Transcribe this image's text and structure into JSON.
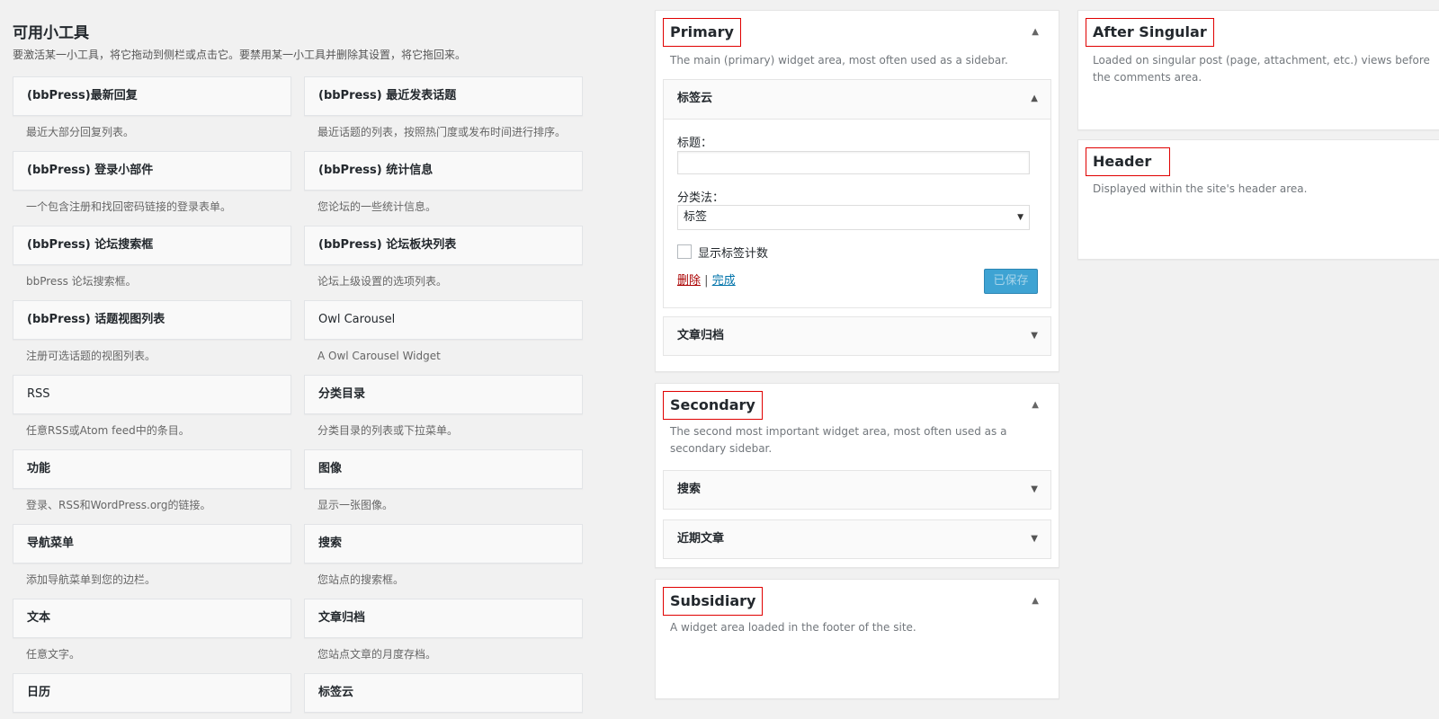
{
  "available": {
    "title": "可用小工具",
    "intro": "要激活某一小工具，将它拖动到侧栏或点击它。要禁用某一小工具并删除其设置，将它拖回来。",
    "widgets": [
      {
        "name": "(bbPress)最新回复",
        "desc": "最近大部分回复列表。"
      },
      {
        "name": "(bbPress) 最近发表话题",
        "desc": "最近话题的列表，按照热门度或发布时间进行排序。"
      },
      {
        "name": "(bbPress) 登录小部件",
        "desc": "一个包含注册和找回密码链接的登录表单。"
      },
      {
        "name": "(bbPress) 统计信息",
        "desc": "您论坛的一些统计信息。"
      },
      {
        "name": "(bbPress) 论坛搜索框",
        "desc": "bbPress 论坛搜索框。"
      },
      {
        "name": "(bbPress) 论坛板块列表",
        "desc": "论坛上级设置的选项列表。"
      },
      {
        "name": "(bbPress) 话题视图列表",
        "desc": "注册可选话题的视图列表。"
      },
      {
        "name": "Owl Carousel",
        "desc": "A Owl Carousel Widget"
      },
      {
        "name": "RSS",
        "desc": "任意RSS或Atom feed中的条目。"
      },
      {
        "name": "分类目录",
        "desc": "分类目录的列表或下拉菜单。"
      },
      {
        "name": "功能",
        "desc": "登录、RSS和WordPress.org的链接。"
      },
      {
        "name": "图像",
        "desc": "显示一张图像。"
      },
      {
        "name": "导航菜单",
        "desc": "添加导航菜单到您的边栏。"
      },
      {
        "name": "搜索",
        "desc": "您站点的搜索框。"
      },
      {
        "name": "文本",
        "desc": "任意文字。"
      },
      {
        "name": "文章归档",
        "desc": "您站点文章的月度存档。"
      },
      {
        "name": "日历",
        "desc": ""
      },
      {
        "name": "标签云",
        "desc": ""
      }
    ]
  },
  "primary": {
    "name": "Primary",
    "desc": "The main (primary) widget area, most often used as a sidebar.",
    "tagcloud": {
      "title": "标签云",
      "title_label": "标题：",
      "title_value": "",
      "taxonomy_label": "分类法：",
      "taxonomy_value": "标签",
      "show_count_label": "显示标签计数",
      "delete_label": "删除",
      "separator": "|",
      "done_label": "完成",
      "saved_label": "已保存"
    },
    "archives_title": "文章归档"
  },
  "secondary": {
    "name": "Secondary",
    "desc": "The second most important widget area, most often used as a secondary sidebar.",
    "widgets": [
      "搜索",
      "近期文章"
    ]
  },
  "subsidiary": {
    "name": "Subsidiary",
    "desc": "A widget area loaded in the footer of the site."
  },
  "after_singular": {
    "name": "After Singular",
    "desc": "Loaded on singular post (page, attachment, etc.) views before the comments area."
  },
  "header": {
    "name": "Header",
    "desc": "Displayed within the site's header area."
  },
  "icons": {
    "collapse": "arrow-up-icon",
    "expand": "arrow-down-icon"
  },
  "colors": {
    "highlight_border": "#e00000",
    "saved_button": "#3ea3d3",
    "delete_link": "#aa0000",
    "done_link": "#0073aa"
  }
}
